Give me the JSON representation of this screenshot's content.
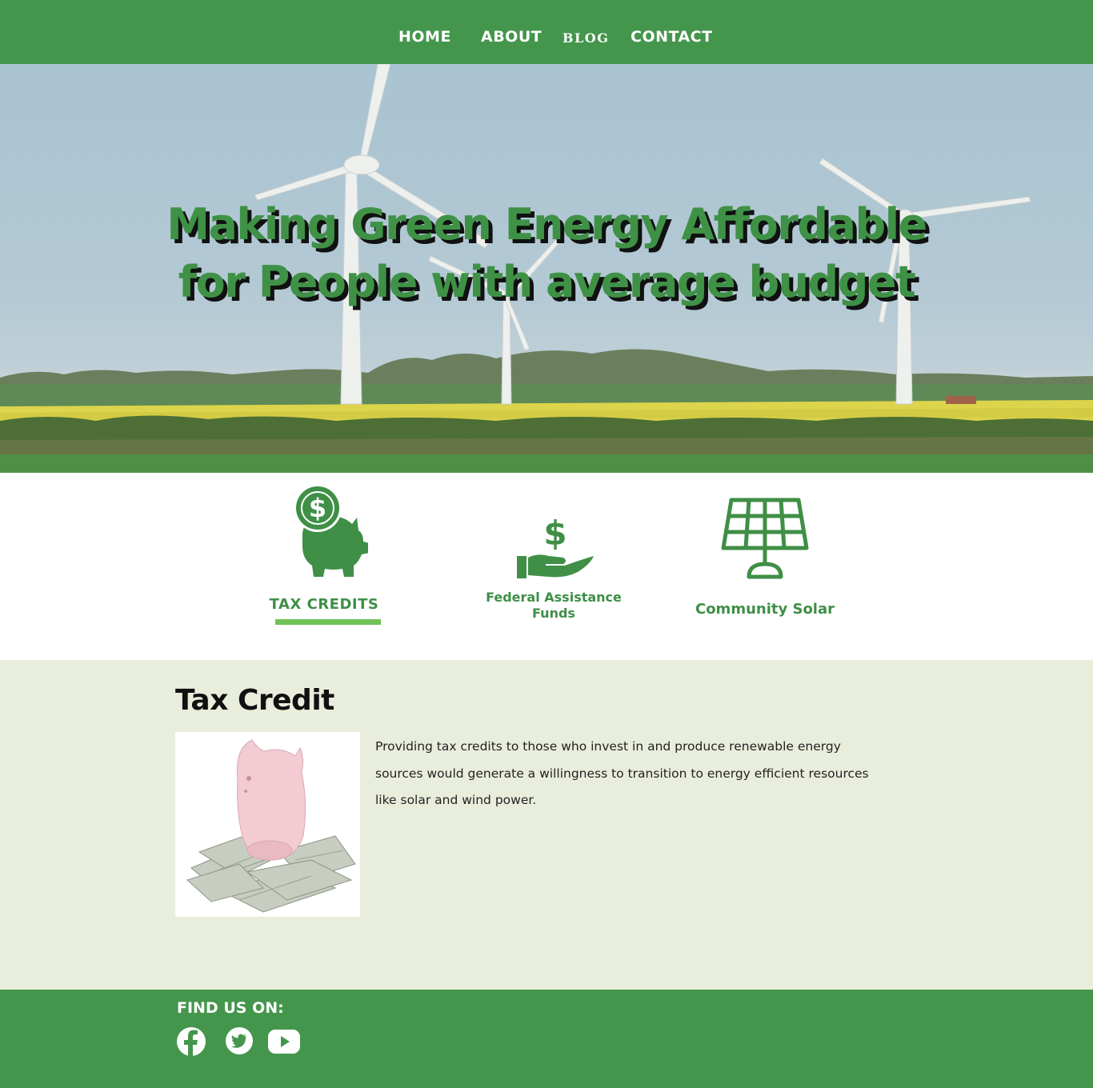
{
  "nav": {
    "home": "HOME",
    "about": "ABOUT",
    "blog": "BLOG",
    "contact": "CONTACT"
  },
  "hero": {
    "title_line1": "Making Green Energy Affordable",
    "title_line2": "for People with average budget",
    "background": "wind-turbines-field-image"
  },
  "features": [
    {
      "label": "TAX CREDITS",
      "icon": "piggy-bank-coin-icon",
      "active": true
    },
    {
      "label_line1": "Federal Assistance",
      "label_line2": "Funds",
      "icon": "dollar-hand-icon"
    },
    {
      "label": "Community Solar",
      "icon": "solar-panel-icon"
    }
  ],
  "section": {
    "title": "Tax Credit",
    "image": "piggy-bank-on-money-photo",
    "body": "Providing tax credits to those who invest in and produce renewable energy sources would generate a willingness to transition to energy efficient resources like solar and wind power."
  },
  "footer": {
    "find_us": "FIND US ON:",
    "social": [
      "facebook-icon",
      "twitter-icon",
      "youtube-icon"
    ]
  },
  "colors": {
    "brand_green": "#44964d",
    "accent_green": "#6fc356",
    "content_bg": "#e9eedc"
  }
}
